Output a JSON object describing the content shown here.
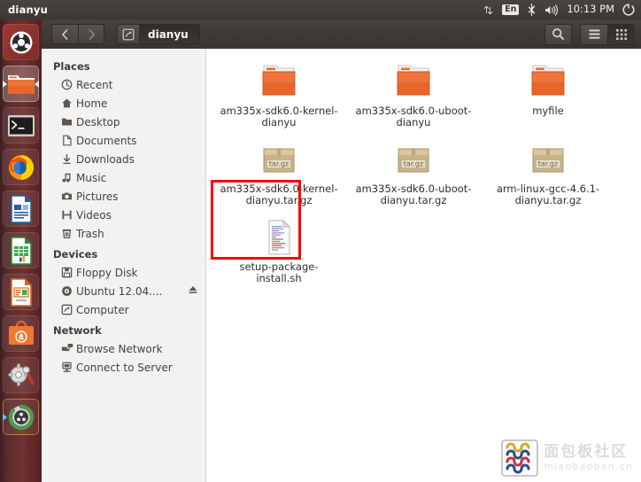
{
  "panel": {
    "title": "dianyu",
    "clock": "10:13 PM",
    "keyboard_layout": "En",
    "indicators": [
      {
        "name": "network-icon",
        "label": "network"
      },
      {
        "name": "keyboard-layout-indicator",
        "label": "En"
      },
      {
        "name": "bluetooth-icon",
        "label": "bluetooth"
      },
      {
        "name": "volume-icon",
        "label": "volume"
      },
      {
        "name": "session-gear-icon",
        "label": "session"
      }
    ]
  },
  "launcher": {
    "items": [
      {
        "name": "ubuntu-dash-icon",
        "label": "Dash Home"
      },
      {
        "name": "files-icon",
        "label": "Files",
        "active": true
      },
      {
        "name": "terminal-icon",
        "label": "Terminal"
      },
      {
        "name": "firefox-icon",
        "label": "Firefox Web Browser"
      },
      {
        "name": "libreoffice-writer-icon",
        "label": "LibreOffice Writer"
      },
      {
        "name": "libreoffice-calc-icon",
        "label": "LibreOffice Calc"
      },
      {
        "name": "libreoffice-impress-icon",
        "label": "LibreOffice Impress"
      },
      {
        "name": "ubuntu-software-center-icon",
        "label": "Ubuntu Software Center"
      },
      {
        "name": "system-settings-icon",
        "label": "System Settings"
      },
      {
        "name": "software-updater-icon",
        "label": "Software Updater"
      }
    ]
  },
  "toolbar": {
    "back_label": "‹",
    "forward_label": "›",
    "path_current": "dianyu",
    "search_label": "search",
    "menu_label": "menu",
    "view_label": "view"
  },
  "sidebar": {
    "sections": [
      {
        "heading": "Places",
        "items": [
          {
            "label": "Recent",
            "icon": "clock-icon"
          },
          {
            "label": "Home",
            "icon": "home-icon"
          },
          {
            "label": "Desktop",
            "icon": "folder-icon"
          },
          {
            "label": "Documents",
            "icon": "document-icon"
          },
          {
            "label": "Downloads",
            "icon": "download-icon"
          },
          {
            "label": "Music",
            "icon": "music-note-icon"
          },
          {
            "label": "Pictures",
            "icon": "camera-icon"
          },
          {
            "label": "Videos",
            "icon": "film-icon"
          },
          {
            "label": "Trash",
            "icon": "trash-icon"
          }
        ]
      },
      {
        "heading": "Devices",
        "items": [
          {
            "label": "Floppy Disk",
            "icon": "floppy-disk-icon"
          },
          {
            "label": "Ubuntu 12.04....",
            "icon": "disc-icon",
            "eject": true
          },
          {
            "label": "Computer",
            "icon": "computer-icon"
          }
        ]
      },
      {
        "heading": "Network",
        "items": [
          {
            "label": "Browse Network",
            "icon": "network-browse-icon"
          },
          {
            "label": "Connect to Server",
            "icon": "server-connect-icon"
          }
        ]
      }
    ]
  },
  "content": {
    "files": [
      {
        "label": "am335x-sdk6.0-kernel-dianyu",
        "type": "folder"
      },
      {
        "label": "am335x-sdk6.0-uboot-dianyu",
        "type": "folder"
      },
      {
        "label": "myfile",
        "type": "folder"
      },
      {
        "label": "am335x-sdk6.0-kernel-dianyu.tar.gz",
        "type": "archive",
        "badge": "tar.gz"
      },
      {
        "label": "am335x-sdk6.0-uboot-dianyu.tar.gz",
        "type": "archive",
        "badge": "tar.gz"
      },
      {
        "label": "arm-linux-gcc-4.6.1-dianyu.tar.gz",
        "type": "archive",
        "badge": "tar.gz"
      },
      {
        "label": "setup-package-install.sh",
        "type": "script",
        "highlighted": true
      }
    ],
    "highlight_color": "#ff0000"
  },
  "watermark": {
    "cn": "面包板社区",
    "en": "mianbaoban.cn"
  },
  "colors": {
    "panel": "#3f3b38",
    "launcher": "#5b2b2c",
    "toolbar": "#3d3935",
    "sidebar": "#f3f2f1",
    "folder": "#e8662a",
    "archive": "#c9b48a",
    "accent_red": "#ff0000"
  }
}
